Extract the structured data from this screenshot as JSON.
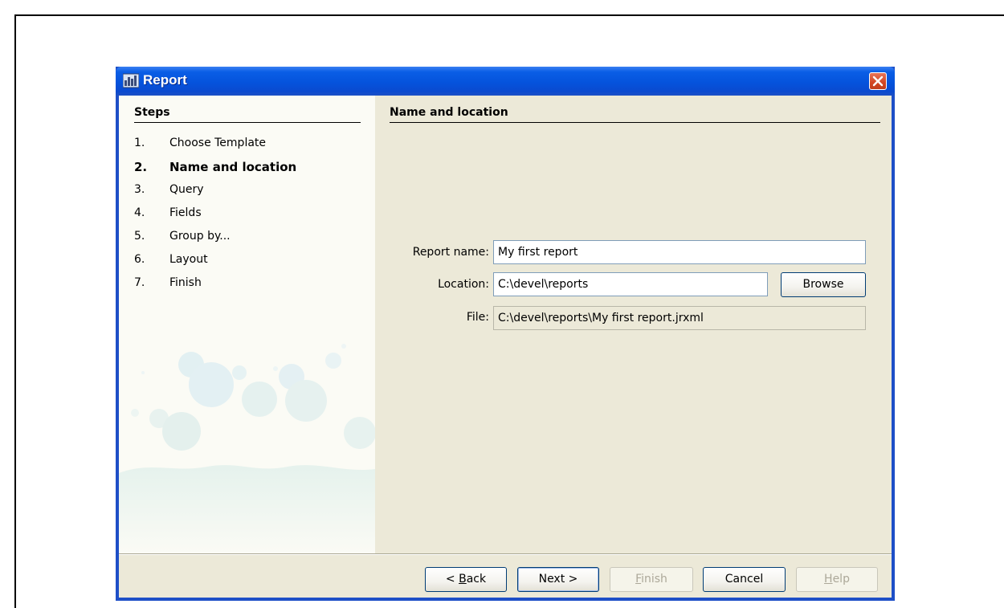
{
  "window": {
    "title": "Report"
  },
  "steps": {
    "title": "Steps",
    "items": [
      {
        "num": "1.",
        "label": "Choose Template",
        "active": false
      },
      {
        "num": "2.",
        "label": "Name and location",
        "active": true
      },
      {
        "num": "3.",
        "label": "Query",
        "active": false
      },
      {
        "num": "4.",
        "label": "Fields",
        "active": false
      },
      {
        "num": "5.",
        "label": "Group by...",
        "active": false
      },
      {
        "num": "6.",
        "label": "Layout",
        "active": false
      },
      {
        "num": "7.",
        "label": "Finish",
        "active": false
      }
    ]
  },
  "main": {
    "title": "Name and location",
    "report_name": {
      "label": "Report name:",
      "value": "My first report"
    },
    "location": {
      "label": "Location:",
      "value": "C:\\devel\\reports",
      "browse_label": "Browse"
    },
    "file": {
      "label": "File:",
      "value": "C:\\devel\\reports\\My first report.jrxml"
    }
  },
  "buttons": {
    "back": {
      "pre": "< ",
      "mnemonic": "B",
      "post": "ack",
      "enabled": true
    },
    "next": {
      "label": "Next >",
      "enabled": true
    },
    "finish": {
      "mnemonic": "F",
      "post": "inish",
      "enabled": false
    },
    "cancel": {
      "label": "Cancel",
      "enabled": true
    },
    "help": {
      "mnemonic": "H",
      "post": "elp",
      "enabled": false
    }
  },
  "colors": {
    "titlebar": "#0553dc",
    "client_bg": "#ece9d8",
    "steps_bg": "#fbfbf5",
    "close_button": "#d24522"
  }
}
